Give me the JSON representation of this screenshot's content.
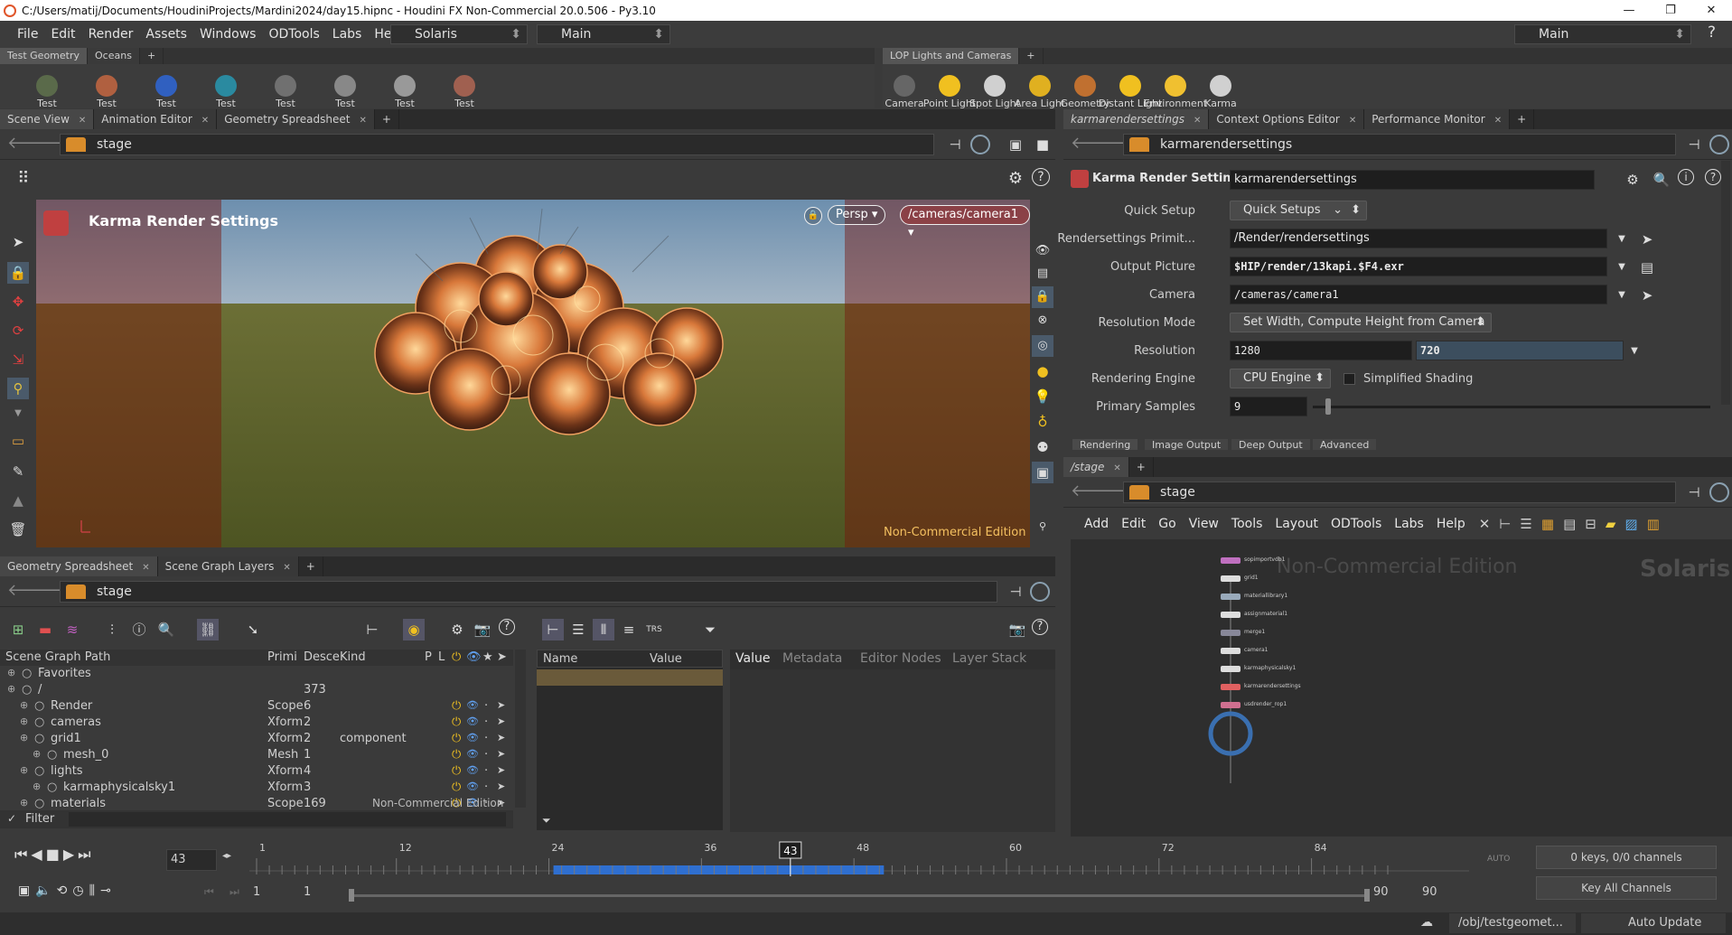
{
  "window": {
    "title": "C:/Users/matij/Documents/HoudiniProjects/Mardini2024/day15.hipnc - Houdini FX Non-Commercial 20.0.506 - Py3.10"
  },
  "menu": {
    "items": [
      "File",
      "Edit",
      "Render",
      "Assets",
      "Windows",
      "ODTools",
      "Labs",
      "Help"
    ],
    "desktop": "Solaris",
    "context": "Main",
    "right_desktop": "Main"
  },
  "shelf_left": {
    "tabs": [
      "Test Geometry",
      "Oceans"
    ],
    "tools": [
      {
        "label": "Test\nGeometry: ...",
        "color": "#5a6a4a"
      },
      {
        "label": "Test\nGeometry: ...",
        "color": "#b06040"
      },
      {
        "label": "Test\nGeometry: ...",
        "color": "#3060c0"
      },
      {
        "label": "Test\nGeometry: S...",
        "color": "#2a8aa0"
      },
      {
        "label": "Test\nGeometry: S...",
        "color": "#707070"
      },
      {
        "label": "Test\nGeometry: T...",
        "color": "#888"
      },
      {
        "label": "Test\nGeometry: T...",
        "color": "#999"
      },
      {
        "label": "Test\nGeometry: T...",
        "color": "#a06050"
      }
    ]
  },
  "shelf_right": {
    "tabs": [
      "LOP Lights and Cameras"
    ],
    "tools": [
      {
        "label": "Camera",
        "color": "#666"
      },
      {
        "label": "Point Light",
        "color": "#f0c020"
      },
      {
        "label": "Spot Light",
        "color": "#d0d0d0"
      },
      {
        "label": "Area Light",
        "color": "#e0b020"
      },
      {
        "label": "Geometry\nLight",
        "color": "#c07030"
      },
      {
        "label": "Distant Light",
        "color": "#f0c020"
      },
      {
        "label": "Environment\nLight",
        "color": "#f0c030"
      },
      {
        "label": "Karma\nPhysical Sk...",
        "color": "#d0d0d0"
      }
    ]
  },
  "viewer": {
    "tabs": [
      "Scene View",
      "Animation Editor",
      "Geometry Spreadsheet"
    ],
    "path": "stage",
    "overlay_title": "Karma Render Settings",
    "persp": "Persp",
    "camera": "/cameras/camera1",
    "watermark": "Non-Commercial Edition"
  },
  "params": {
    "tabs": [
      "karmarendersettings",
      "Context Options Editor",
      "Performance Monitor"
    ],
    "node_type": "Karma Render Settings",
    "node_name": "karmarendersettings",
    "rows": [
      {
        "label": "Quick Setup",
        "value": "Quick Setups"
      },
      {
        "label": "Rendersettings Primit...",
        "value": "/Render/rendersettings"
      },
      {
        "label": "Output Picture",
        "value": "$HIP/render/13kapi.$F4.exr"
      },
      {
        "label": "Camera",
        "value": "/cameras/camera1"
      },
      {
        "label": "Resolution Mode",
        "value": "Set Width, Compute Height from Camera"
      },
      {
        "label": "Resolution",
        "value": "1280",
        "value2": "720"
      },
      {
        "label": "Rendering Engine",
        "value": "CPU Engine",
        "extra": "Simplified Shading"
      },
      {
        "label": "Primary Samples",
        "value": "9"
      }
    ],
    "subtabs": [
      "Rendering",
      "Image Output",
      "Deep Output",
      "Advanced"
    ]
  },
  "network": {
    "tabs": [
      "/stage"
    ],
    "path": "stage",
    "menu": [
      "Add",
      "Edit",
      "Go",
      "View",
      "Tools",
      "Layout",
      "ODTools",
      "Labs",
      "Help"
    ],
    "watermark": "Non-Commercial Edition",
    "context": "Solaris",
    "nodes": [
      {
        "name": "sopimportvdb1"
      },
      {
        "name": "grid1"
      },
      {
        "name": "materiallibrary1"
      },
      {
        "name": "assignmaterial1"
      },
      {
        "name": "merge1"
      },
      {
        "name": "camera1"
      },
      {
        "name": "karmaphysicalsky1"
      },
      {
        "name": "karmarendersettings"
      },
      {
        "name": "usdrender_rop1"
      }
    ]
  },
  "spreadsheet": {
    "tabs": [
      "Geometry Spreadsheet",
      "Scene Graph Layers"
    ],
    "path": "stage",
    "headers": [
      "Scene Graph Path",
      "Primi",
      "Desce",
      "Kind",
      "P",
      "L"
    ],
    "rows": [
      {
        "name": "Favorites",
        "type": "",
        "desc": "",
        "kind": "",
        "indent": 0
      },
      {
        "name": "/",
        "type": "",
        "desc": "373",
        "kind": "",
        "indent": 0
      },
      {
        "name": "Render",
        "type": "Scope",
        "desc": "6",
        "kind": "",
        "indent": 1
      },
      {
        "name": "cameras",
        "type": "Xform",
        "desc": "2",
        "kind": "",
        "indent": 1
      },
      {
        "name": "grid1",
        "type": "Xform",
        "desc": "2",
        "kind": "component",
        "indent": 1
      },
      {
        "name": "mesh_0",
        "type": "Mesh",
        "desc": "1",
        "kind": "",
        "indent": 2
      },
      {
        "name": "lights",
        "type": "Xform",
        "desc": "4",
        "kind": "",
        "indent": 1
      },
      {
        "name": "karmaphysicalsky1",
        "type": "Xform",
        "desc": "3",
        "kind": "",
        "indent": 2
      },
      {
        "name": "materials",
        "type": "Scope",
        "desc": "169",
        "kind": "",
        "indent": 1
      }
    ],
    "watermark": "Non-Commercial Edition",
    "filter": "Filter",
    "detail_headers": [
      "Name",
      "Value"
    ],
    "detail_tabs": [
      "Value",
      "Metadata",
      "Editor Nodes",
      "Layer Stack"
    ]
  },
  "timeline": {
    "frame": "43",
    "ticks": [
      "1",
      "12",
      "24",
      "36",
      "48",
      "60",
      "72",
      "84"
    ],
    "start": "1",
    "start2": "1",
    "end": "90",
    "end2": "90",
    "keys": "0 keys, 0/0 channels",
    "key_all": "Key All Channels"
  },
  "statusbar": {
    "path": "/obj/testgeomet...",
    "update": "Auto Update"
  }
}
